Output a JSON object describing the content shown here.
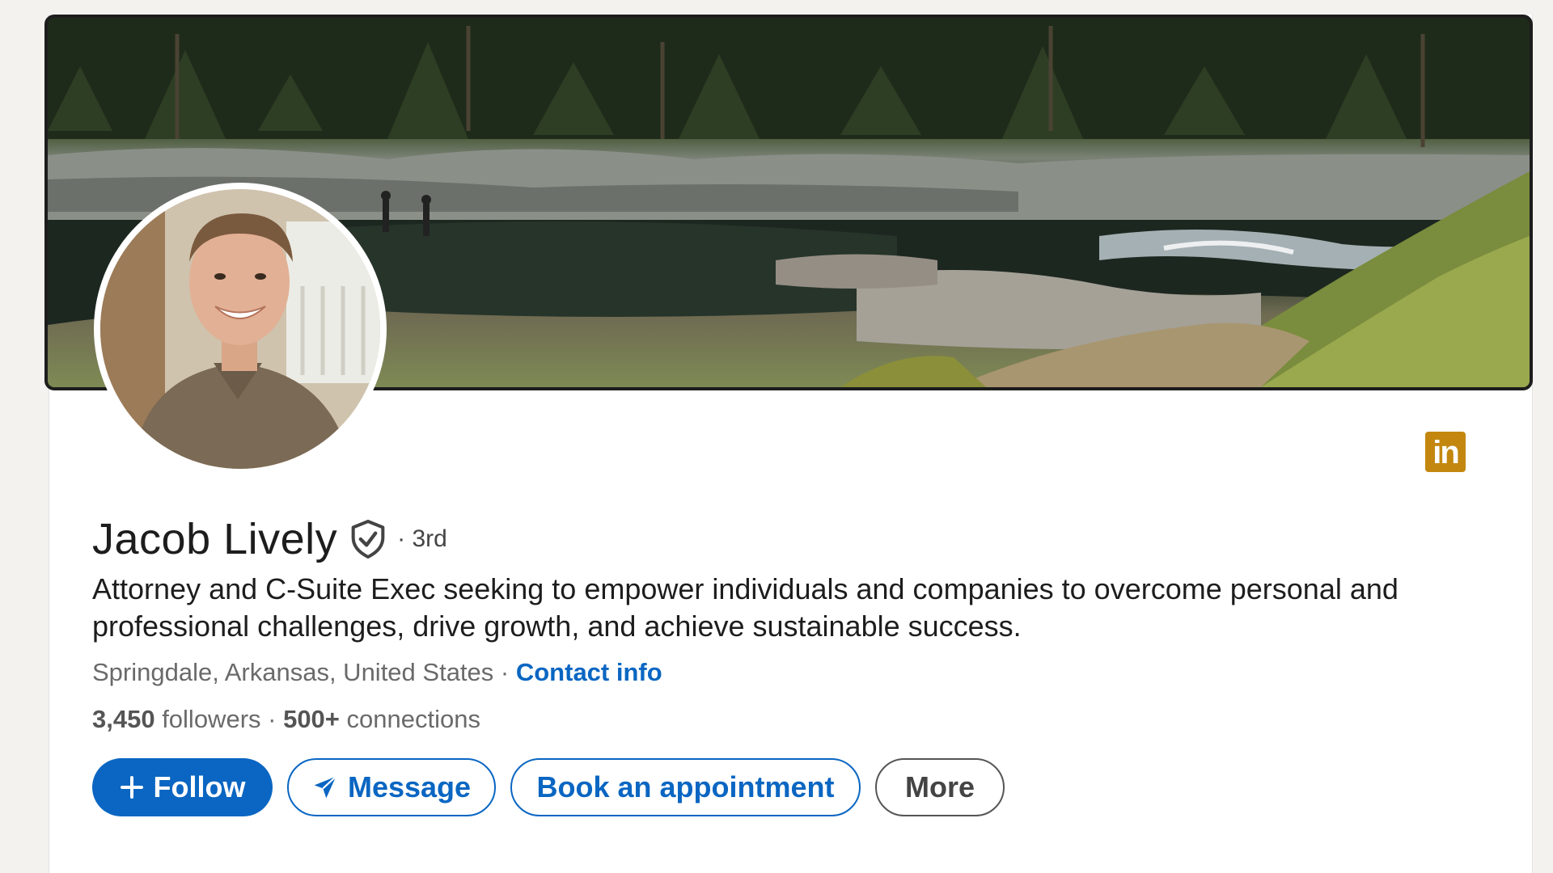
{
  "profile": {
    "name": "Jacob Lively",
    "degree": "· 3rd",
    "headline": "Attorney and C-Suite Exec seeking to empower individuals and companies to overcome personal and professional challenges, drive growth, and achieve sustainable success.",
    "location": "Springdale, Arkansas, United States",
    "separator": " · ",
    "contact_label": "Contact info",
    "followers_count": "3,450",
    "followers_label": " followers",
    "stats_separator": " · ",
    "connections_count": "500+",
    "connections_label": " connections"
  },
  "actions": {
    "follow_label": "Follow",
    "message_label": "Message",
    "book_label": "Book an appointment",
    "more_label": "More"
  },
  "badge": {
    "linkedin_logo_text": "in"
  },
  "icons": {
    "verified": "shield-check-icon",
    "follow": "plus-icon",
    "message": "paper-plane-icon",
    "brand": "linkedin-logo-icon"
  },
  "colors": {
    "primary": "#0a66c2",
    "brand_badge": "#c3870f",
    "text": "#1d1d1d",
    "muted": "#6a6a6a"
  }
}
